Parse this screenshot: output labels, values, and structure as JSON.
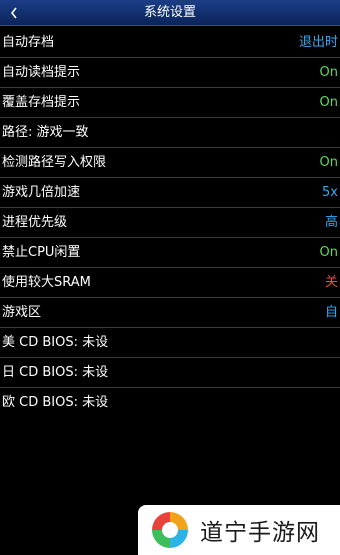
{
  "header": {
    "title": "系统设置"
  },
  "colors": {
    "header_bg": "#12306e",
    "value_blue": "#3aa6f0",
    "value_green": "#5fd95f",
    "value_red": "#e8503a"
  },
  "settings": [
    {
      "label": "自动存档",
      "value": "退出时",
      "value_color": "#3aa6f0"
    },
    {
      "label": "自动读档提示",
      "value": "On",
      "value_color": "#5fd95f"
    },
    {
      "label": "覆盖存档提示",
      "value": "On",
      "value_color": "#5fd95f"
    },
    {
      "label": "路径: 游戏一致",
      "value": "",
      "value_color": "#3aa6f0"
    },
    {
      "label": "检测路径写入权限",
      "value": "On",
      "value_color": "#5fd95f"
    },
    {
      "label": "游戏几倍加速",
      "value": "5x",
      "value_color": "#3aa6f0"
    },
    {
      "label": "进程优先级",
      "value": "高",
      "value_color": "#3aa6f0"
    },
    {
      "label": "禁止CPU闲置",
      "value": "On",
      "value_color": "#5fd95f"
    },
    {
      "label": "使用较大SRAM",
      "value": "关",
      "value_color": "#e8503a"
    },
    {
      "label": "游戏区",
      "value": "自",
      "value_color": "#3aa6f0"
    },
    {
      "label": "美 CD BIOS: 未设",
      "value": "",
      "value_color": "#3aa6f0"
    },
    {
      "label": "日 CD BIOS: 未设",
      "value": "",
      "value_color": "#3aa6f0"
    },
    {
      "label": "欧 CD BIOS: 未设",
      "value": "",
      "value_color": "#3aa6f0"
    }
  ],
  "watermark": {
    "text": "道宁手游网",
    "icon": "swirl-logo-icon"
  }
}
